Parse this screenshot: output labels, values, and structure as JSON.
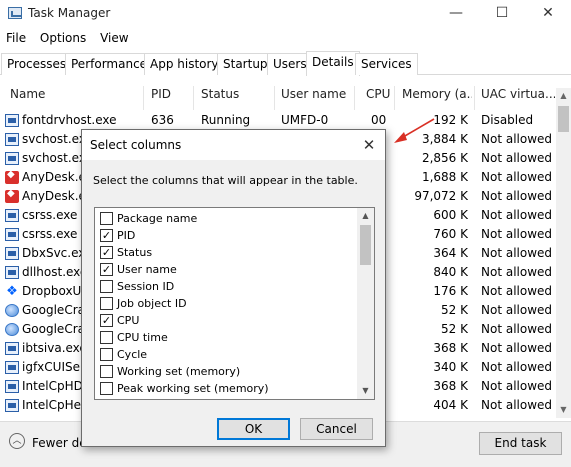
{
  "window": {
    "title": "Task Manager",
    "controls": [
      "—",
      "☐",
      "✕"
    ]
  },
  "menu": [
    "File",
    "Options",
    "View"
  ],
  "tabs": [
    "Processes",
    "Performance",
    "App history",
    "Startup",
    "Users",
    "Details",
    "Services"
  ],
  "active_tab": "Details",
  "columns": [
    "Name",
    "PID",
    "Status",
    "User name",
    "CPU",
    "Memory (a...",
    "UAC virtua..."
  ],
  "rows": [
    {
      "name": "fontdrvhost.exe",
      "pid": "636",
      "status": "Running",
      "user": "UMFD-0",
      "cpu": "00",
      "memory": "192 K",
      "uac": "Disabled",
      "icon": "blue"
    },
    {
      "name": "svchost.exe",
      "pid": "",
      "status": "",
      "user": "",
      "cpu": "",
      "memory": "3,884 K",
      "uac": "Not allowed",
      "icon": "blue"
    },
    {
      "name": "svchost.exe",
      "pid": "",
      "status": "",
      "user": "",
      "cpu": "",
      "memory": "2,856 K",
      "uac": "Not allowed",
      "icon": "blue"
    },
    {
      "name": "AnyDesk.exe",
      "pid": "",
      "status": "",
      "user": "",
      "cpu": "",
      "memory": "1,688 K",
      "uac": "Not allowed",
      "icon": "red"
    },
    {
      "name": "AnyDesk.exe",
      "pid": "",
      "status": "",
      "user": "",
      "cpu": "",
      "memory": "97,072 K",
      "uac": "Not allowed",
      "icon": "red"
    },
    {
      "name": "csrss.exe",
      "pid": "",
      "status": "",
      "user": "",
      "cpu": "",
      "memory": "600 K",
      "uac": "Not allowed",
      "icon": "blue"
    },
    {
      "name": "csrss.exe",
      "pid": "",
      "status": "",
      "user": "",
      "cpu": "",
      "memory": "760 K",
      "uac": "Not allowed",
      "icon": "blue"
    },
    {
      "name": "DbxSvc.exe",
      "pid": "",
      "status": "",
      "user": "",
      "cpu": "",
      "memory": "364 K",
      "uac": "Not allowed",
      "icon": "blue"
    },
    {
      "name": "dllhost.exe",
      "pid": "",
      "status": "",
      "user": "",
      "cpu": "",
      "memory": "840 K",
      "uac": "Not allowed",
      "icon": "blue"
    },
    {
      "name": "DropboxUp",
      "pid": "",
      "status": "",
      "user": "",
      "cpu": "",
      "memory": "176 K",
      "uac": "Not allowed",
      "icon": "drop"
    },
    {
      "name": "GoogleCras",
      "pid": "",
      "status": "",
      "user": "",
      "cpu": "",
      "memory": "52 K",
      "uac": "Not allowed",
      "icon": "globe"
    },
    {
      "name": "GoogleCras",
      "pid": "",
      "status": "",
      "user": "",
      "cpu": "",
      "memory": "52 K",
      "uac": "Not allowed",
      "icon": "globe"
    },
    {
      "name": "ibtsiva.exe",
      "pid": "",
      "status": "",
      "user": "",
      "cpu": "",
      "memory": "368 K",
      "uac": "Not allowed",
      "icon": "blue"
    },
    {
      "name": "igfxCUIServ",
      "pid": "",
      "status": "",
      "user": "",
      "cpu": "",
      "memory": "340 K",
      "uac": "Not allowed",
      "icon": "blue"
    },
    {
      "name": "IntelCpHDC",
      "pid": "",
      "status": "",
      "user": "",
      "cpu": "",
      "memory": "368 K",
      "uac": "Not allowed",
      "icon": "blue"
    },
    {
      "name": "IntelCpHec",
      "pid": "",
      "status": "",
      "user": "",
      "cpu": "",
      "memory": "404 K",
      "uac": "Not allowed",
      "icon": "blue"
    }
  ],
  "footer": {
    "fewer_details": "Fewer det",
    "end_task": "End task"
  },
  "dialog": {
    "title": "Select columns",
    "close": "✕",
    "description": "Select the columns that will appear in the table.",
    "options": [
      {
        "label": "Package name",
        "checked": false
      },
      {
        "label": "PID",
        "checked": true
      },
      {
        "label": "Status",
        "checked": true
      },
      {
        "label": "User name",
        "checked": true
      },
      {
        "label": "Session ID",
        "checked": false
      },
      {
        "label": "Job object ID",
        "checked": false
      },
      {
        "label": "CPU",
        "checked": true
      },
      {
        "label": "CPU time",
        "checked": false
      },
      {
        "label": "Cycle",
        "checked": false
      },
      {
        "label": "Working set (memory)",
        "checked": false
      },
      {
        "label": "Peak working set (memory)",
        "checked": false
      }
    ],
    "ok": "OK",
    "cancel": "Cancel"
  },
  "colors": {
    "accent": "#0078d7",
    "annotation": "#d93025"
  }
}
